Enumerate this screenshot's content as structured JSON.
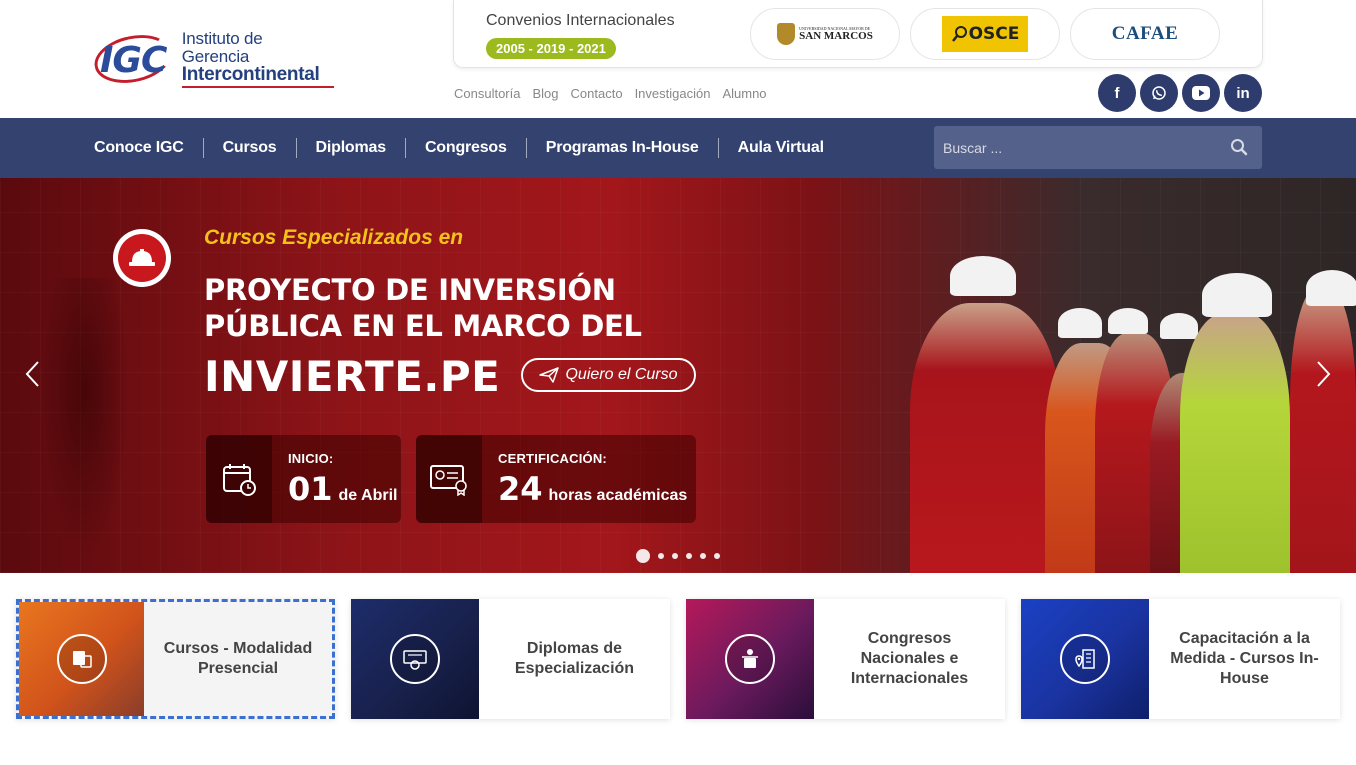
{
  "header": {
    "logo_mark": "IGC",
    "logo_line1": "Instituto de Gerencia",
    "logo_line2": "Intercontinental",
    "convenios_title": "Convenios Internacionales",
    "convenios_years": "2005 - 2019 - 2021",
    "partners": [
      {
        "name": "SAN MARCOS",
        "sub": "UNIVERSIDAD NACIONAL MAYOR DE"
      },
      {
        "name": "OSCE"
      },
      {
        "name": "CAFAE"
      }
    ],
    "top_links": [
      "Consultoría",
      "Blog",
      "Contacto",
      "Investigación",
      "Alumno"
    ],
    "socials": [
      {
        "icon": "facebook-icon",
        "glyph": "f"
      },
      {
        "icon": "whatsapp-icon",
        "glyph": "✆"
      },
      {
        "icon": "youtube-icon",
        "glyph": "▶"
      },
      {
        "icon": "linkedin-icon",
        "glyph": "in"
      }
    ]
  },
  "nav": {
    "items": [
      "Conoce IGC",
      "Cursos",
      "Diplomas",
      "Congresos",
      "Programas In-House",
      "Aula Virtual"
    ],
    "search_placeholder": "Buscar ..."
  },
  "hero": {
    "kicker": "Cursos Especializados en",
    "title_line1": "PROYECTO DE INVERSIÓN",
    "title_line2": "PÚBLICA EN EL MARCO DEL",
    "title_big": "INVIERTE.PE",
    "cta": "Quiero el Curso",
    "inicio_label": "INICIO:",
    "inicio_day": "01",
    "inicio_month": "de Abril",
    "cert_label": "CERTIFICACIÓN:",
    "cert_hours": "24",
    "cert_unit": "horas académicas",
    "slides_total": 6,
    "slide_active": 1
  },
  "cards": [
    {
      "label": "Cursos - Modalidad Presencial",
      "icon": "classroom-icon"
    },
    {
      "label": "Diplomas de Especialización",
      "icon": "diploma-icon"
    },
    {
      "label": "Congresos Nacionales e Internacionales",
      "icon": "speaker-podium-icon"
    },
    {
      "label": "Capacitación a la Medida - Cursos In-House",
      "icon": "building-location-icon"
    }
  ],
  "colors": {
    "nav_bg": "#33426f",
    "accent_green": "#9cb91d",
    "hero_red": "#a3171b",
    "kicker_yellow": "#f2c21b",
    "social_bg": "#2e3b6d"
  }
}
